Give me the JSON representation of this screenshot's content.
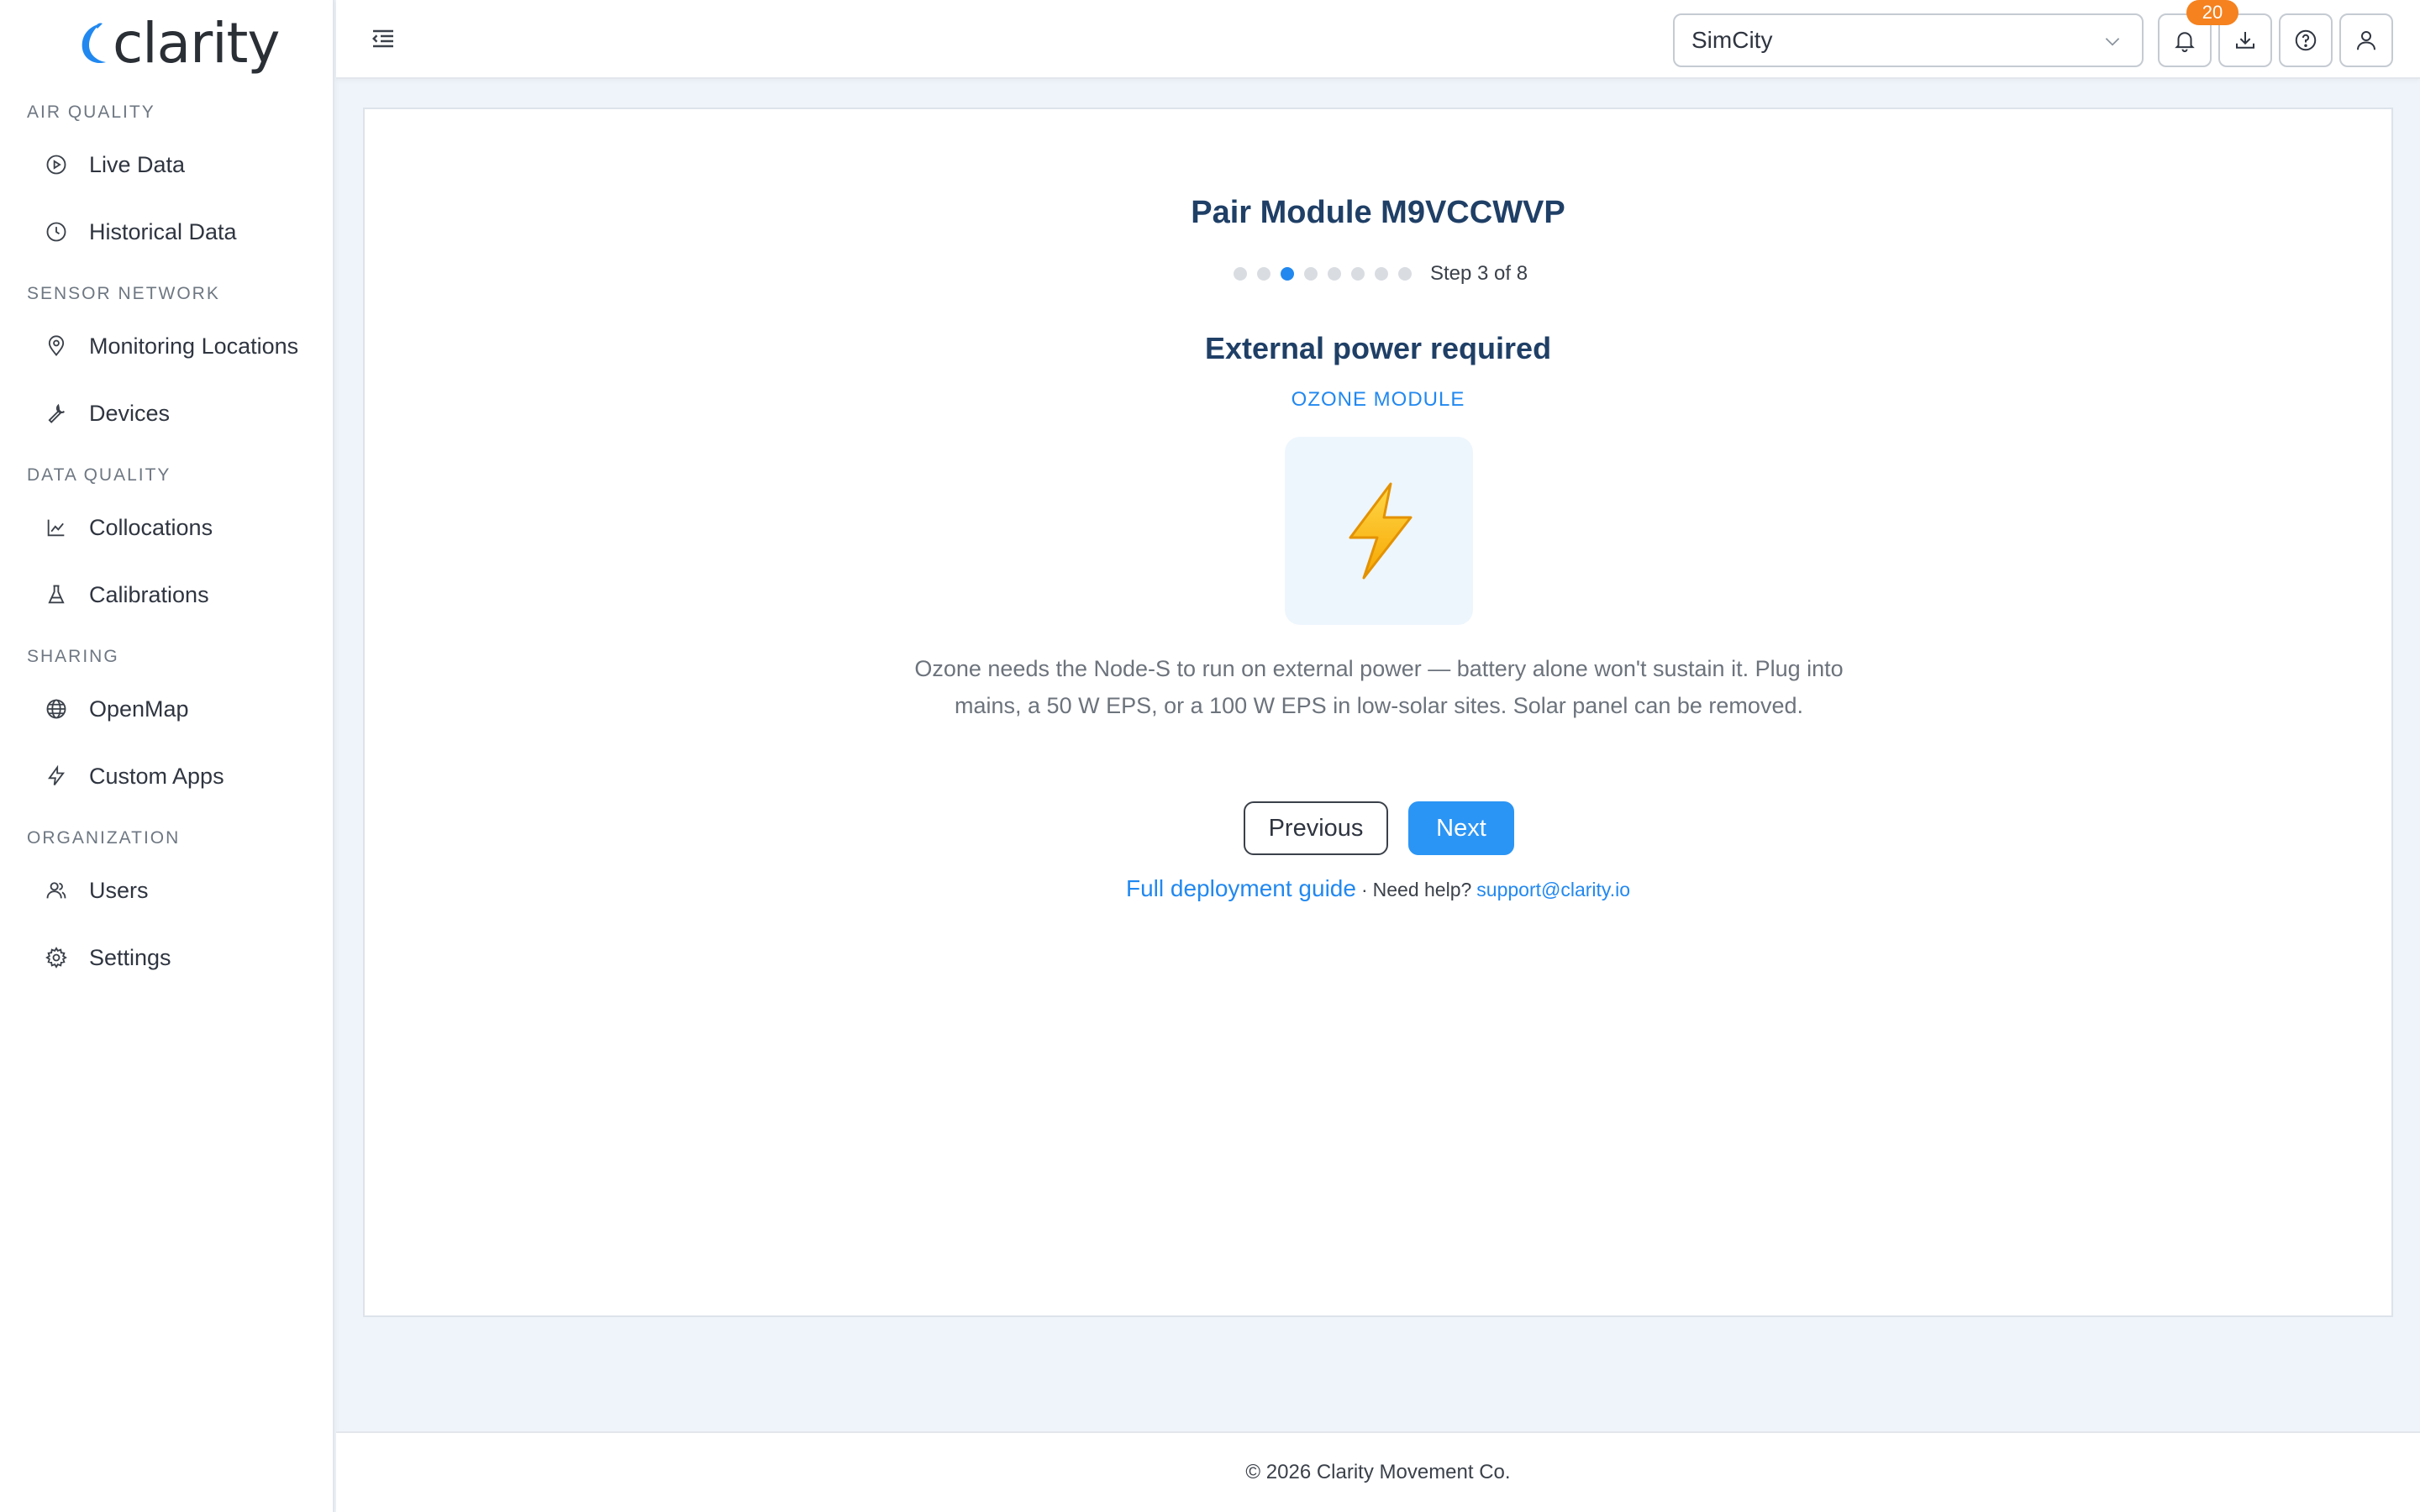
{
  "app": {
    "logo_text": "clarity",
    "brand_color": "#2188f0"
  },
  "sidebar": {
    "sections": [
      {
        "label": "AIR QUALITY",
        "items": [
          {
            "label": "Live Data",
            "icon": "play-circle-icon"
          },
          {
            "label": "Historical Data",
            "icon": "clock-icon"
          }
        ]
      },
      {
        "label": "SENSOR NETWORK",
        "items": [
          {
            "label": "Monitoring Locations",
            "icon": "map-pin-icon"
          },
          {
            "label": "Devices",
            "icon": "wrench-icon"
          }
        ]
      },
      {
        "label": "DATA QUALITY",
        "items": [
          {
            "label": "Collocations",
            "icon": "line-chart-icon"
          },
          {
            "label": "Calibrations",
            "icon": "flask-icon"
          }
        ]
      },
      {
        "label": "SHARING",
        "items": [
          {
            "label": "OpenMap",
            "icon": "globe-icon"
          },
          {
            "label": "Custom Apps",
            "icon": "lightning-icon"
          }
        ]
      },
      {
        "label": "ORGANIZATION",
        "items": [
          {
            "label": "Users",
            "icon": "users-icon"
          },
          {
            "label": "Settings",
            "icon": "gear-icon"
          }
        ]
      }
    ]
  },
  "header": {
    "org_selected": "SimCity",
    "notifications_count": "20"
  },
  "wizard": {
    "title": "Pair Module M9VCCWVP",
    "step_label": "Step 3 of 8",
    "current_step": 3,
    "total_steps": 8,
    "subtitle": "External power required",
    "module_tag": "OZONE MODULE",
    "description": "Ozone needs the Node-S to run on external power — battery alone won't sustain it. Plug into mains, a 50 W EPS, or a 100 W EPS in low-solar sites. Solar panel can be removed.",
    "previous_label": "Previous",
    "next_label": "Next",
    "guide_link": "Full deployment guide",
    "help_separator": "·",
    "help_text": "Need help?",
    "support_email": "support@clarity.io"
  },
  "footer": {
    "copyright": "© 2026 Clarity Movement Co."
  }
}
